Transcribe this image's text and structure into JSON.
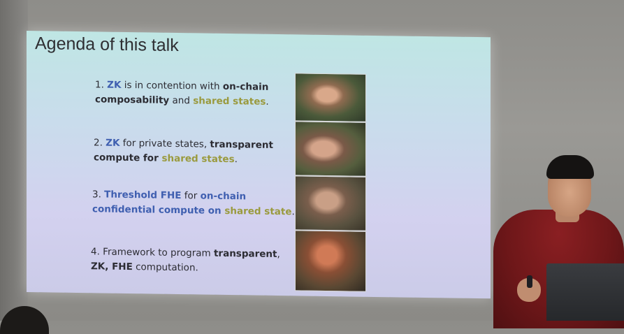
{
  "slide": {
    "title": "Agenda of this talk",
    "items": [
      {
        "num": "1. ",
        "zk": "ZK",
        "t1": " is in contention with ",
        "b1": "on-chain",
        "b2": "composability",
        "t2": " and ",
        "shared": "shared states",
        "t3": "."
      },
      {
        "num": "2. ",
        "zk": "ZK",
        "t1": " for private states, ",
        "b1": "transparent",
        "b2": "compute for ",
        "shared": "shared states",
        "t3": "."
      },
      {
        "num": "3. ",
        "b0": "Threshold FHE",
        "t1": " for ",
        "b1": "on-chain",
        "b2": "confidential compute on ",
        "shared": "shared state",
        "t3": "."
      },
      {
        "num": "4. ",
        "t0": "Framework to program ",
        "b1": "transparent",
        "t1": ",",
        "b2": "ZK, FHE",
        "t2": " computation."
      }
    ]
  },
  "colors": {
    "slide_top": "#bfe6e4",
    "slide_bottom": "#cbcbe8",
    "zk_blue": "#3f5fb0",
    "shared_olive": "#9a9a3e",
    "presenter_shirt": "#7a1b1d"
  }
}
